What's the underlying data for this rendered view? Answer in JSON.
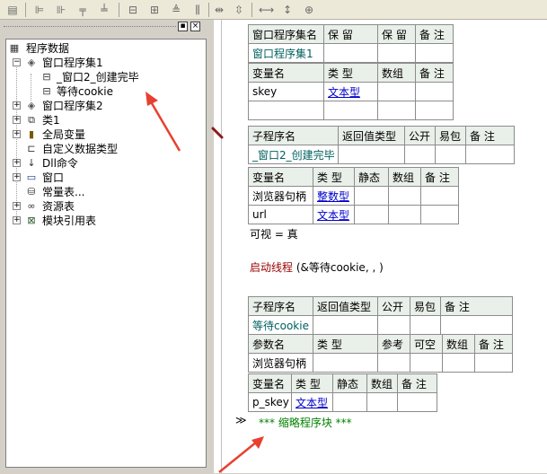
{
  "toolbar": {
    "icons": [
      "form-icon",
      "align-left-icon",
      "align-center-icon",
      "align-top-icon",
      "align-bottom-icon",
      "center-h-icon",
      "center-v-icon",
      "same-width-icon",
      "same-height-icon",
      "h-spacing-icon",
      "v-spacing-icon",
      "fit-width-icon",
      "fit-height-icon",
      "fit-size-icon"
    ]
  },
  "panel": {
    "pin_glyph": "▪",
    "close_glyph": "×"
  },
  "tree": {
    "root": "程序数据",
    "group1": "窗口程序集1",
    "group1_child1": "_窗口2_创建完毕",
    "group1_child2": "等待cookie",
    "group2": "窗口程序集2",
    "class": "类1",
    "globals": "全局变量",
    "custom_types": "自定义数据类型",
    "dll": "Dll命令",
    "window": "窗口",
    "constants": "常量表...",
    "resources": "资源表",
    "modules": "模块引用表"
  },
  "assembly_table": {
    "headers": [
      "窗口程序集名",
      "保 留",
      "保 留",
      "备 注"
    ],
    "row": [
      "窗口程序集1",
      "",
      "",
      ""
    ]
  },
  "assembly_vars": {
    "headers": [
      "变量名",
      "类 型",
      "数组",
      "备 注"
    ],
    "rows": [
      [
        "skey",
        "文本型",
        "",
        ""
      ],
      [
        "",
        "",
        "",
        ""
      ]
    ]
  },
  "sub1": {
    "headers": [
      "子程序名",
      "返回值类型",
      "公开",
      "易包",
      "备 注"
    ],
    "row": [
      "_窗口2_创建完毕",
      "",
      "",
      "",
      ""
    ]
  },
  "sub1_locals": {
    "headers": [
      "变量名",
      "类 型",
      "静态",
      "数组",
      "备 注"
    ],
    "rows": [
      [
        "浏览器句柄",
        "整数型",
        "",
        "",
        ""
      ],
      [
        "url",
        "文本型",
        "",
        "",
        ""
      ]
    ]
  },
  "code": {
    "line1": "可视 = 真",
    "line2_kw": "启动线程",
    "line2_args": " (&等待cookie, , )"
  },
  "sub2": {
    "headers": [
      "子程序名",
      "返回值类型",
      "公开",
      "易包",
      "备 注"
    ],
    "row": [
      "等待cookie",
      "",
      "",
      "",
      ""
    ]
  },
  "sub2_params": {
    "headers": [
      "参数名",
      "类 型",
      "参考",
      "可空",
      "数组",
      "备 注"
    ],
    "row": [
      "浏览器句柄",
      "",
      "",
      "",
      "",
      ""
    ]
  },
  "sub2_locals": {
    "headers": [
      "变量名",
      "类 型",
      "静态",
      "数组",
      "备 注"
    ],
    "row": [
      "p_skey",
      "文本型",
      "",
      "",
      ""
    ]
  },
  "folded": {
    "marker": "≫",
    "text": "*** 缩略程序块 ***"
  },
  "colors": {
    "annotation_arrow": "#e8402f",
    "link": "#0000cc",
    "keyword": "#990000",
    "comment": "#008000",
    "header_bg": "#e9efe9"
  }
}
